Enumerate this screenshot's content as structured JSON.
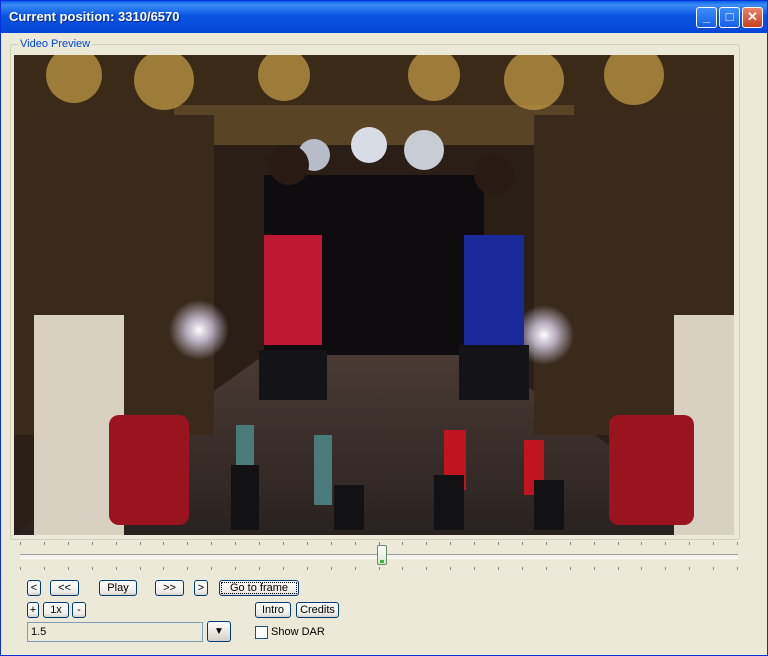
{
  "window": {
    "title": "Current position: 3310/6570",
    "controls": {
      "minimize": "_",
      "maximize": "□",
      "close": "✕"
    }
  },
  "preview": {
    "group_label": "Video Preview"
  },
  "seek": {
    "position": 3310,
    "total": 6570
  },
  "buttons": {
    "prev": "<",
    "rewind": "<<",
    "play": "Play",
    "forward": ">>",
    "next": ">",
    "goto": "Go to frame",
    "plus": "+",
    "speed": "1x",
    "minus": "-",
    "intro": "Intro",
    "credits": "Credits"
  },
  "combo": {
    "value": "1.5",
    "arrow": "▼"
  },
  "show_dar": {
    "label": "Show DAR",
    "checked": false
  }
}
